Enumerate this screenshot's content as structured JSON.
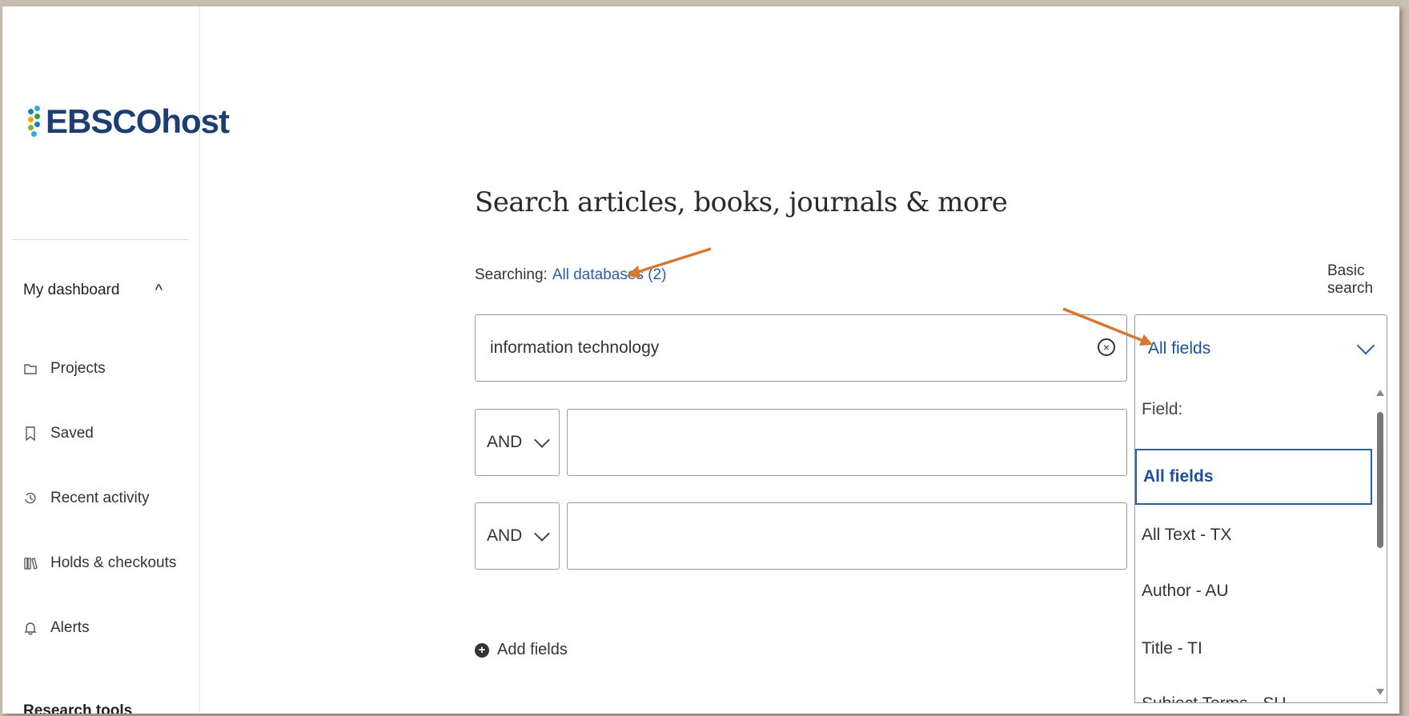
{
  "app": {
    "logo_text": "EBSCOhost"
  },
  "sidebar": {
    "section_title": "My dashboard",
    "section_caret": "^",
    "items": [
      {
        "label": "Projects",
        "icon": "folder-icon"
      },
      {
        "label": "Saved",
        "icon": "bookmark-icon"
      },
      {
        "label": "Recent activity",
        "icon": "history-icon"
      },
      {
        "label": "Holds & checkouts",
        "icon": "books-icon"
      },
      {
        "label": "Alerts",
        "icon": "bell-icon"
      }
    ],
    "next_section_partial": "Research tools"
  },
  "main": {
    "heading": "Search articles, books, journals & more",
    "searching_label": "Searching:",
    "databases_link": "All databases (2)",
    "basic_search_link": "Basic search",
    "search_value": "information technology",
    "rows": [
      {
        "operator": "AND",
        "value": ""
      },
      {
        "operator": "AND",
        "value": ""
      }
    ],
    "add_fields_label": "Add fields"
  },
  "field_dropdown": {
    "selected": "All fields",
    "group_label": "Field:",
    "options": [
      "All fields",
      "All Text - TX",
      "Author - AU",
      "Title - TI",
      "Subject Terms - SU"
    ]
  },
  "colors": {
    "link": "#2b5fa8",
    "annotation_arrow": "#d9772e",
    "logo_text": "#1d3e73"
  }
}
